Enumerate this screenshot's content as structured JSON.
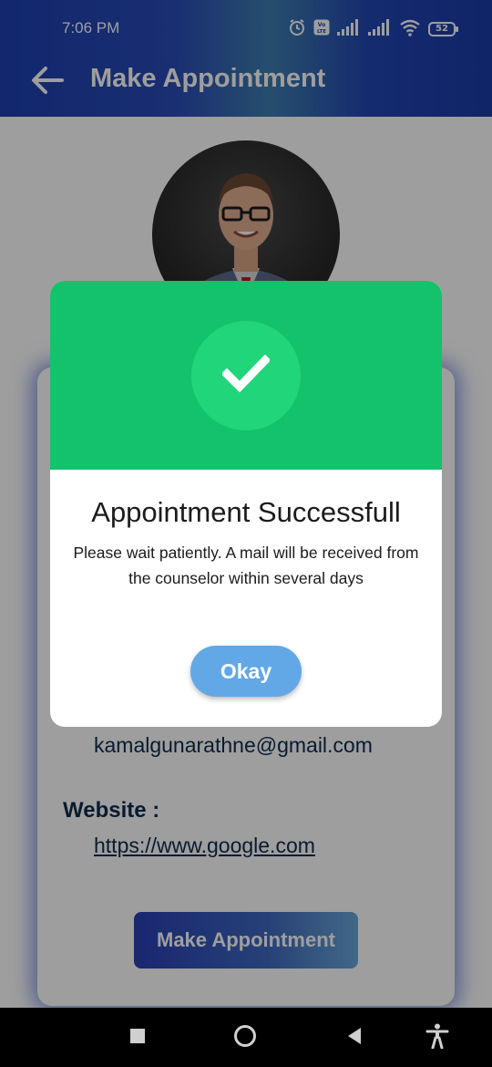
{
  "status_bar": {
    "time": "7:06 PM",
    "battery_level": "52",
    "icons": [
      "alarm-icon",
      "volte-icon",
      "signal-icon",
      "signal-icon",
      "wifi-icon",
      "battery-icon"
    ]
  },
  "app_bar": {
    "title": "Make Appointment",
    "back_icon": "back-arrow-icon"
  },
  "profile": {
    "email": "kamalgunarathne@gmail.com",
    "website_label": "Website :",
    "website_url": "https://www.google.com",
    "make_appointment_label": "Make Appointment"
  },
  "dialog": {
    "title": "Appointment Successfull",
    "message": "Please wait patiently. A mail will be received from the counselor within several days",
    "okay_label": "Okay",
    "icon": "checkmark-icon"
  },
  "colors": {
    "header_green": "#14c26b",
    "check_circle": "#20d57a",
    "okay_button": "#63a8e6",
    "app_bar_blue": "#1d3fb0",
    "text_dark_blue": "#0f2a4d"
  },
  "nav_bar": {
    "icons": [
      "recent-apps-icon",
      "home-icon",
      "back-icon",
      "accessibility-icon"
    ]
  }
}
